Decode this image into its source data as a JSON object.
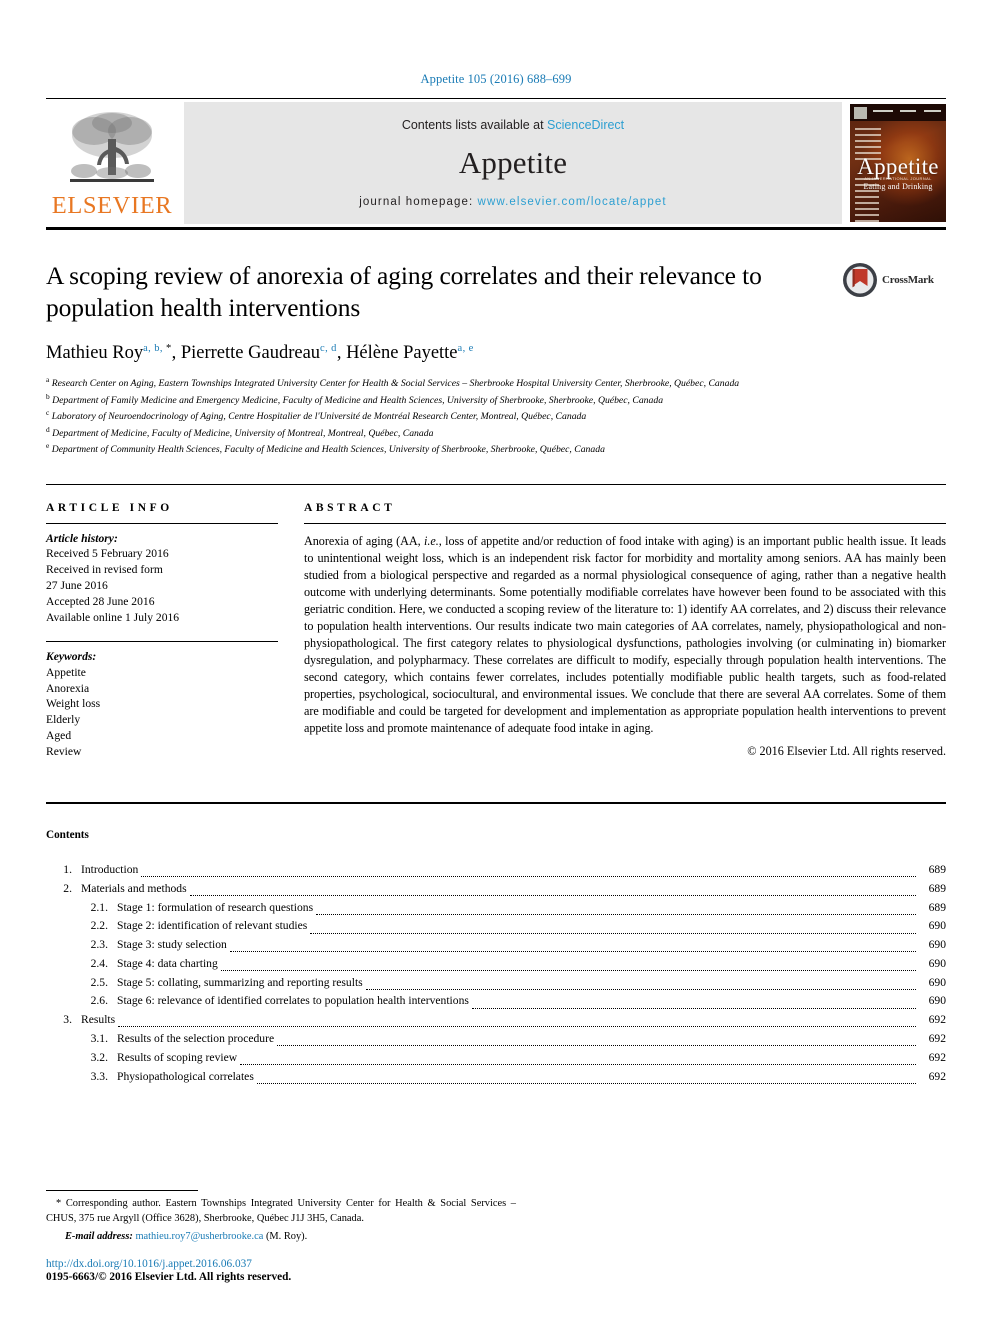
{
  "running_head": "Appetite 105 (2016) 688–699",
  "masthead": {
    "publisher_logo_text": "ELSEVIER",
    "contents_prefix": "Contents lists available at ",
    "contents_link": "ScienceDirect",
    "journal_name": "Appetite",
    "homepage_prefix": "journal homepage: ",
    "homepage_url": "www.elsevier.com/locate/appet",
    "cover": {
      "title": "Appetite",
      "subtitle_small": "AN INTERNATIONAL JOURNAL",
      "subtitle": "Eating and Drinking"
    },
    "colors": {
      "link": "#2d9fd1",
      "elsevier_orange": "#e87722",
      "panel_bg": "#e6e6e6"
    }
  },
  "article": {
    "title": "A scoping review of anorexia of aging correlates and their relevance to population health interventions",
    "authors": [
      {
        "name": "Mathieu Roy",
        "sups": "a, b, ",
        "star": "*"
      },
      {
        "name": "Pierrette Gaudreau",
        "sups": "c, d",
        "star": ""
      },
      {
        "name": "Hélène Payette",
        "sups": "a, e",
        "star": ""
      }
    ],
    "affiliations": [
      {
        "mark": "a",
        "text": "Research Center on Aging, Eastern Townships Integrated University Center for Health & Social Services – Sherbrooke Hospital University Center, Sherbrooke, Québec, Canada"
      },
      {
        "mark": "b",
        "text": "Department of Family Medicine and Emergency Medicine, Faculty of Medicine and Health Sciences, University of Sherbrooke, Sherbrooke, Québec, Canada"
      },
      {
        "mark": "c",
        "text": "Laboratory of Neuroendocrinology of Aging, Centre Hospitalier de l'Université de Montréal Research Center, Montreal, Québec, Canada"
      },
      {
        "mark": "d",
        "text": "Department of Medicine, Faculty of Medicine, University of Montreal, Montreal, Québec, Canada"
      },
      {
        "mark": "e",
        "text": "Department of Community Health Sciences, Faculty of Medicine and Health Sciences, University of Sherbrooke, Sherbrooke, Québec, Canada"
      }
    ],
    "crossmark_label": "CrossMark"
  },
  "article_info": {
    "heading": "ARTICLE INFO",
    "history_label": "Article history:",
    "history_lines": [
      "Received 5 February 2016",
      "Received in revised form",
      "27 June 2016",
      "Accepted 28 June 2016",
      "Available online 1 July 2016"
    ],
    "keywords_label": "Keywords:",
    "keywords": [
      "Appetite",
      "Anorexia",
      "Weight loss",
      "Elderly",
      "Aged",
      "Review"
    ]
  },
  "abstract": {
    "heading": "ABSTRACT",
    "part1": "Anorexia of aging (AA, ",
    "italic1": "i.e.",
    "part2": ", loss of appetite and/or reduction of food intake with aging) is an important public health issue. It leads to unintentional weight loss, which is an independent risk factor for morbidity and mortality among seniors. AA has mainly been studied from a biological perspective and regarded as a normal physiological consequence of aging, rather than a negative health outcome with underlying determinants. Some potentially modifiable correlates have however been found to be associated with this geriatric condition. Here, we conducted a scoping review of the literature to: 1) identify AA correlates, and 2) discuss their relevance to population health interventions. Our results indicate two main categories of AA correlates, namely, physiopathological and non-physiopathological. The first category relates to physiological dysfunctions, pathologies involving (or culminating in) biomarker dysregulation, and polypharmacy. These correlates are difficult to modify, especially through population health interventions. The second category, which contains fewer correlates, includes potentially modifiable public health targets, such as food-related properties, psychological, sociocultural, and environmental issues. We conclude that there are several AA correlates. Some of them are modifiable and could be targeted for development and implementation as appropriate population health interventions to prevent appetite loss and promote maintenance of adequate food intake in aging.",
    "copyright": "© 2016 Elsevier Ltd. All rights reserved."
  },
  "contents": {
    "heading": "Contents",
    "items": [
      {
        "level": 1,
        "num": "1.",
        "label": "Introduction",
        "page": "689"
      },
      {
        "level": 1,
        "num": "2.",
        "label": "Materials and methods",
        "page": "689"
      },
      {
        "level": 2,
        "num": "2.1.",
        "label": "Stage 1: formulation of research questions",
        "page": "689"
      },
      {
        "level": 2,
        "num": "2.2.",
        "label": "Stage 2: identification of relevant studies",
        "page": "690"
      },
      {
        "level": 2,
        "num": "2.3.",
        "label": "Stage 3: study selection",
        "page": "690"
      },
      {
        "level": 2,
        "num": "2.4.",
        "label": "Stage 4: data charting",
        "page": "690"
      },
      {
        "level": 2,
        "num": "2.5.",
        "label": "Stage 5: collating, summarizing and reporting results",
        "page": "690"
      },
      {
        "level": 2,
        "num": "2.6.",
        "label": "Stage 6: relevance of identified correlates to population health interventions",
        "page": "690"
      },
      {
        "level": 1,
        "num": "3.",
        "label": "Results",
        "page": "692"
      },
      {
        "level": 2,
        "num": "3.1.",
        "label": "Results of the selection procedure",
        "page": "692"
      },
      {
        "level": 2,
        "num": "3.2.",
        "label": "Results of scoping review",
        "page": "692"
      },
      {
        "level": 2,
        "num": "3.3.",
        "label": "Physiopathological correlates",
        "page": "692"
      }
    ]
  },
  "footer": {
    "corresponding_star": "*",
    "corresponding_text": "Corresponding author. Eastern Townships Integrated University Center for Health & Social Services – CHUS, 375 rue Argyll (Office 3628), Sherbrooke, Québec J1J 3H5, Canada.",
    "email_label": "E-mail address:",
    "email": "mathieu.roy7@usherbrooke.ca",
    "email_suffix": "(M. Roy).",
    "doi": "http://dx.doi.org/10.1016/j.appet.2016.06.037",
    "issn_line": "0195-6663/© 2016 Elsevier Ltd. All rights reserved."
  }
}
